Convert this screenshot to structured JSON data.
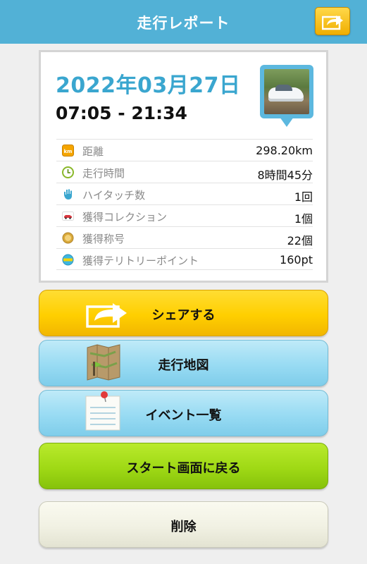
{
  "header": {
    "title": "走行レポート",
    "share_icon": "share-arrow-icon"
  },
  "report": {
    "date": "2022年03月27日",
    "time_range": "07:05 - 21:34",
    "photo_icon": "car-photo-pin",
    "stats": [
      {
        "icon": "km-icon",
        "label": "距離",
        "value": "298.20km"
      },
      {
        "icon": "clock-icon",
        "label": "走行時間",
        "value": "8時間45分"
      },
      {
        "icon": "hand-icon",
        "label": "ハイタッチ数",
        "value": "1回"
      },
      {
        "icon": "car-collection-icon",
        "label": "獲得コレクション",
        "value": "1個"
      },
      {
        "icon": "medal-icon",
        "label": "獲得称号",
        "value": "22個"
      },
      {
        "icon": "spot-icon",
        "label": "獲得テリトリーポイント",
        "value": "160pt"
      }
    ]
  },
  "actions": {
    "share": "シェアする",
    "map": "走行地図",
    "events": "イベント一覧",
    "back_to_start": "スタート画面に戻る",
    "delete": "削除"
  },
  "colors": {
    "header": "#52b1d6",
    "date_text": "#3aa6cf",
    "share_button": "#ffcf00",
    "blue_button": "#98dbf3",
    "green_button": "#9fd915",
    "delete_button": "#f1f1e3"
  }
}
